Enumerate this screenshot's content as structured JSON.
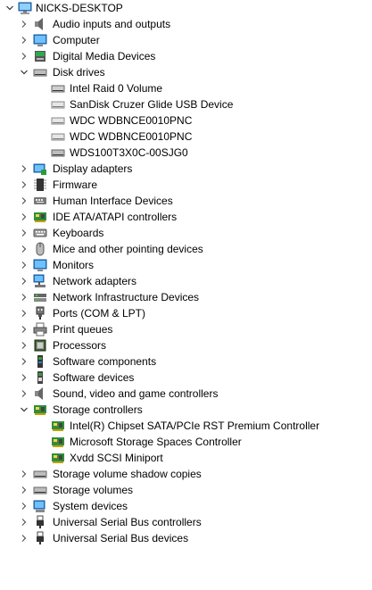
{
  "root": {
    "label": "NICKS-DESKTOP"
  },
  "categories": {
    "audio": "Audio inputs and outputs",
    "computer": "Computer",
    "digital_media": "Digital Media Devices",
    "disk_drives": "Disk drives",
    "display": "Display adapters",
    "firmware": "Firmware",
    "hid": "Human Interface Devices",
    "ide": "IDE ATA/ATAPI controllers",
    "keyboards": "Keyboards",
    "mice": "Mice and other pointing devices",
    "monitors": "Monitors",
    "network_adapters": "Network adapters",
    "network_infra": "Network Infrastructure Devices",
    "ports": "Ports (COM & LPT)",
    "print_queues": "Print queues",
    "processors": "Processors",
    "software_components": "Software components",
    "software_devices": "Software devices",
    "sound": "Sound, video and game controllers",
    "storage_controllers": "Storage controllers",
    "shadow_copies": "Storage volume shadow copies",
    "storage_volumes": "Storage volumes",
    "system_devices": "System devices",
    "usb_controllers": "Universal Serial Bus controllers",
    "usb_devices": "Universal Serial Bus devices"
  },
  "disk_drive_items": [
    "Intel Raid 0 Volume",
    "SanDisk Cruzer Glide USB Device",
    "WDC  WDBNCE0010PNC",
    "WDC  WDBNCE0010PNC",
    "WDS100T3X0C-00SJG0"
  ],
  "storage_controller_items": [
    "Intel(R) Chipset SATA/PCIe RST Premium Controller",
    "Microsoft Storage Spaces Controller",
    "Xvdd SCSI Miniport"
  ]
}
